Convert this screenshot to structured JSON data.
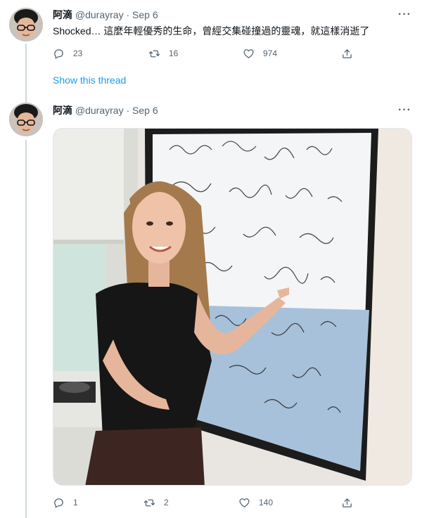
{
  "tweet1": {
    "author_name": "阿滴",
    "author_handle": "@durayray",
    "separator": "·",
    "date": "Sep 6",
    "text": "Shocked… 這麼年輕優秀的生命，曾經交集碰撞過的靈魂，就這樣消逝了",
    "replies": "23",
    "retweets": "16",
    "likes": "974",
    "more": "···"
  },
  "show_thread_label": "Show this thread",
  "tweet2": {
    "author_name": "阿滴",
    "author_handle": "@durayray",
    "separator": "·",
    "date": "Sep 6",
    "replies": "1",
    "retweets": "2",
    "likes": "140",
    "more": "···"
  },
  "colors": {
    "link": "#1d9bf0",
    "muted": "#536471",
    "thread_line": "#cfd9de"
  },
  "icons": [
    "reply-icon",
    "retweet-icon",
    "like-icon",
    "share-icon",
    "more-icon"
  ]
}
